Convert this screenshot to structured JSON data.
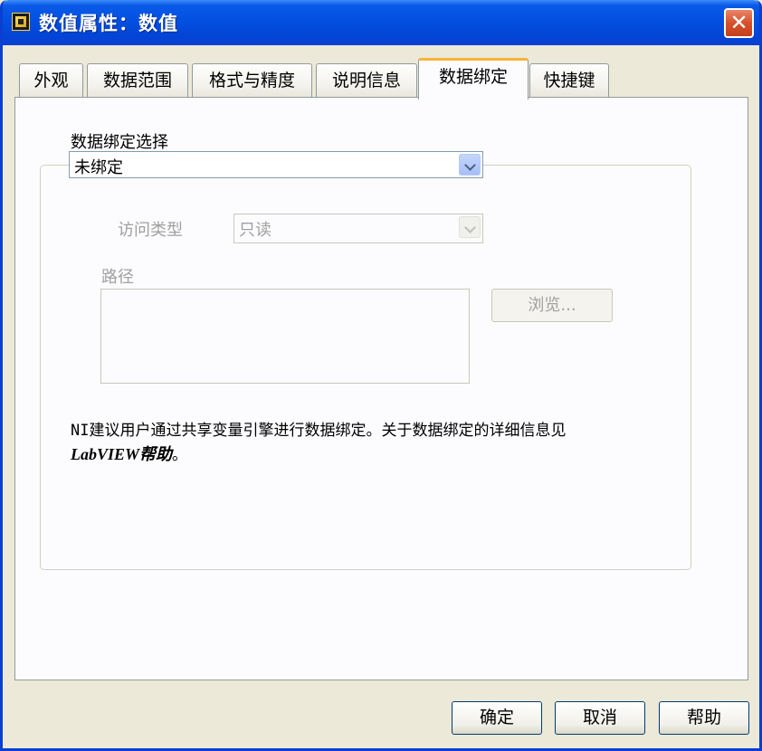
{
  "window": {
    "title": "数值属性：数值",
    "close_symbol": "✕"
  },
  "tabs": [
    {
      "label": "外观",
      "active": false
    },
    {
      "label": "数据范围",
      "active": false
    },
    {
      "label": "格式与精度",
      "active": false
    },
    {
      "label": "说明信息",
      "active": false
    },
    {
      "label": "数据绑定",
      "active": true
    },
    {
      "label": "快捷键",
      "active": false
    }
  ],
  "binding": {
    "select_label": "数据绑定选择",
    "select_value": "未绑定",
    "access_label": "访问类型",
    "access_value": "只读",
    "path_label": "路径",
    "path_value": "",
    "browse_label": "浏览..."
  },
  "note": {
    "text": "NI建议用户通过共享变量引擎进行数据绑定。关于数据绑定的详细信息见",
    "link_text": "LabVIEW帮助",
    "trailing": "。"
  },
  "buttons": {
    "ok": "确定",
    "cancel": "取消",
    "help": "帮助"
  },
  "colors": {
    "titlebar": "#0350e0",
    "active_tab_accent": "#f8b33a",
    "close_button": "#d6502c"
  }
}
